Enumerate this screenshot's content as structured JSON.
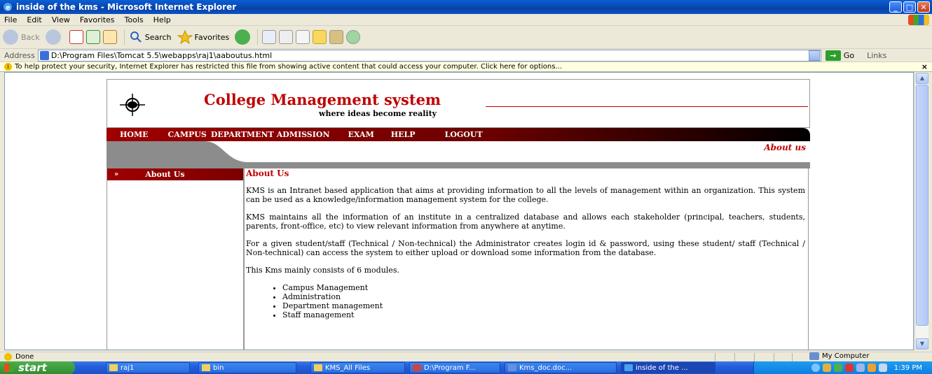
{
  "window": {
    "title": "inside of the kms - Microsoft Internet Explorer",
    "buttons": {
      "minimize": "_",
      "maximize": "□",
      "close": "✕"
    }
  },
  "menu": [
    "File",
    "Edit",
    "View",
    "Favorites",
    "Tools",
    "Help"
  ],
  "toolbar": {
    "back": "Back",
    "search": "Search",
    "favorites": "Favorites"
  },
  "address": {
    "label": "Address",
    "url": "D:\\Program Files\\Tomcat 5.5\\webapps\\raj1\\aaboutus.html",
    "go": "Go",
    "links": "Links"
  },
  "infobar": {
    "text": "To help protect your security, Internet Explorer has restricted this file from showing active content that could access your computer. Click here for options..."
  },
  "site": {
    "title": "College Management system",
    "tagline": "where ideas become reality",
    "nav": [
      "HOME",
      "CAMPUS",
      "DEPARTMENT",
      "ADMISSION",
      "EXAM",
      "HELP",
      "LOGOUT"
    ],
    "crumb": "About us",
    "sidebar_heading": "About Us",
    "main_heading": "About Us",
    "paragraphs": [
      "KMS is an Intranet based application that aims at providing information to all the levels of management within an organization. This system can be used as a knowledge/information management system for the college.",
      "KMS maintains all the information of an institute in a centralized database and allows each stakeholder (principal, teachers, students, parents, front-office, etc) to view relevant information from anywhere at anytime.",
      "For a given student/staff (Technical / Non-technical) the Administrator creates login id & password, using these student/ staff (Technical / Non-technical) can access the system to either upload or download some information from the database.",
      "This Kms mainly consists of 6 modules."
    ],
    "modules": [
      "Campus Management",
      "Administration",
      "Department management",
      "Staff management"
    ]
  },
  "status": {
    "text": "Done",
    "zone": "My Computer"
  },
  "taskbar": {
    "start": "start",
    "tasks": [
      "raj1",
      "bin",
      "KMS_All Files",
      "D:\\Program F...",
      "Kms_doc.doc...",
      "inside of the ..."
    ],
    "clock": "1:39 PM"
  },
  "colors": {
    "brand_red": "#c00000",
    "xp_blue": "#245edb"
  }
}
